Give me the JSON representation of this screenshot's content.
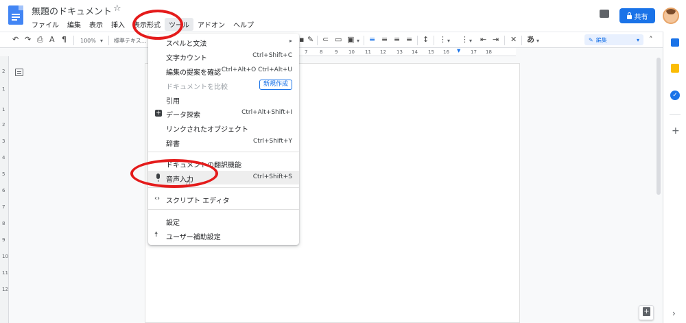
{
  "header": {
    "doc_title": "無題のドキュメント",
    "share_label": "共有"
  },
  "menubar": {
    "items": [
      "ファイル",
      "編集",
      "表示",
      "挿入",
      "表示形式",
      "ツール",
      "アドオン",
      "ヘルプ"
    ],
    "active": "ツール"
  },
  "toolbar": {
    "zoom": "100%",
    "style": "標準テキス…",
    "editing_label": "編集",
    "text_style": "あ"
  },
  "ruler": {
    "h_ticks": [
      "7",
      "8",
      "9",
      "10",
      "11",
      "12",
      "13",
      "14",
      "15",
      "16",
      "17",
      "18"
    ],
    "v_ticks": [
      "2",
      "1",
      "1",
      "2",
      "3",
      "4",
      "5",
      "6",
      "7",
      "8",
      "9",
      "10",
      "11",
      "12"
    ]
  },
  "tools_menu": {
    "items": [
      {
        "label": "スペルと文法",
        "shortcut": "",
        "submenu": true
      },
      {
        "label": "文字カウント",
        "shortcut": "Ctrl+Shift+C"
      },
      {
        "label": "編集の提案を確認",
        "shortcut": "Ctrl+Alt+O Ctrl+Alt+U"
      },
      {
        "label": "ドキュメントを比較",
        "shortcut": "",
        "badge": "新規作成",
        "disabled": true
      },
      {
        "label": "引用",
        "shortcut": ""
      },
      {
        "label": "データ探索",
        "shortcut": "Ctrl+Alt+Shift+I"
      },
      {
        "label": "リンクされたオブジェクト",
        "shortcut": ""
      },
      {
        "label": "辞書",
        "shortcut": "Ctrl+Shift+Y"
      },
      {
        "label": "ドキュメントの翻訳機能",
        "shortcut": ""
      },
      {
        "label": "音声入力",
        "shortcut": "Ctrl+Shift+S",
        "highlighted": true
      },
      {
        "label": "スクリプト エディタ",
        "shortcut": ""
      },
      {
        "label": "設定",
        "shortcut": ""
      },
      {
        "label": "ユーザー補助設定",
        "shortcut": ""
      }
    ]
  },
  "colors": {
    "accent": "#1a73e8",
    "annotation": "#e41b1b",
    "doc_icon": "#4285f4"
  }
}
